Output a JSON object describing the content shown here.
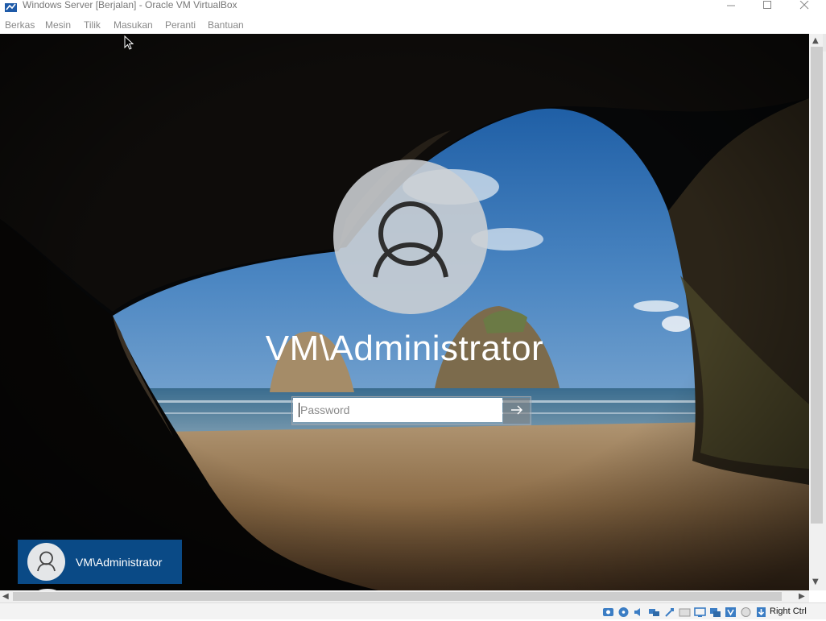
{
  "window": {
    "title": "Windows Server [Berjalan] - Oracle VM VirtualBox",
    "controls": [
      "minimize-icon",
      "maximize-icon",
      "close-icon"
    ]
  },
  "menu": {
    "items": [
      {
        "label": "Berkas"
      },
      {
        "label": "Mesin"
      },
      {
        "label": "Tilik"
      },
      {
        "label": "Masukan"
      },
      {
        "label": "Peranti"
      },
      {
        "label": "Bantuan"
      }
    ]
  },
  "lockscreen": {
    "username": "VM\\Administrator",
    "password_placeholder": "Password",
    "password_value": "",
    "submit_icon": "arrow-right-icon",
    "user_tile_name": "VM\\Administrator",
    "tile_color": "#0a4a86"
  },
  "statusbar": {
    "icons": [
      "hard-disk-icon",
      "optical-drive-icon",
      "audio-icon",
      "network-icon",
      "usb-icon",
      "shared-folders-icon",
      "display-icon",
      "video-capture-icon",
      "virtualization-icon",
      "mouse-integration-icon",
      "keyboard-capture-icon"
    ],
    "host_key": "Right Ctrl"
  }
}
